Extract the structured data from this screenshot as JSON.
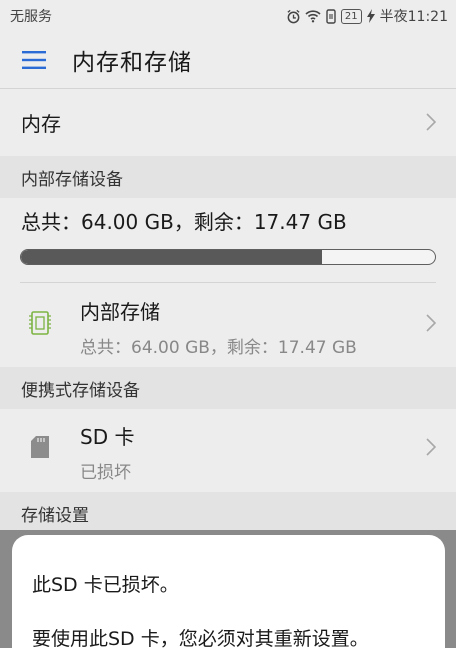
{
  "status_bar": {
    "carrier": "无服务",
    "battery_text": "21",
    "time": "半夜11:21"
  },
  "header": {
    "title": "内存和存储"
  },
  "memory_row": {
    "label": "内存"
  },
  "internal_section": {
    "header": "内部存储设备",
    "summary": "总共：64.00 GB，剩余：17.47 GB",
    "used_fraction": 0.7274,
    "item": {
      "title": "内部存储",
      "subtitle": "总共：64.00 GB，剩余：17.47 GB"
    }
  },
  "portable_section": {
    "header": "便携式存储设备",
    "item": {
      "title": "SD 卡",
      "subtitle": "已损坏"
    }
  },
  "settings_section": {
    "header": "存储设置"
  },
  "dialog": {
    "title": "此SD 卡已损坏。",
    "body": "要使用此SD 卡，您必须对其重新设置。"
  }
}
